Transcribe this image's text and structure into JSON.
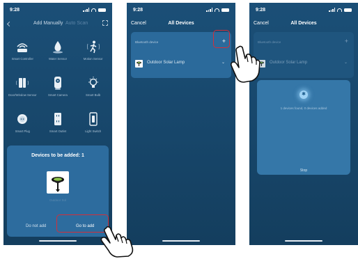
{
  "phone1": {
    "status_time": "9:28",
    "tabs": {
      "add_manually": "Add Manually",
      "auto_scan": "Auto Scan"
    },
    "devices": [
      {
        "label": "Smart Controller",
        "icon": "router-icon"
      },
      {
        "label": "Water Sensor",
        "icon": "water-drop-icon"
      },
      {
        "label": "Motion Sensor",
        "icon": "motion-person-icon"
      },
      {
        "label": "Door/Window Sensor",
        "icon": "door-sensor-icon"
      },
      {
        "label": "Smart Camera",
        "icon": "camera-icon"
      },
      {
        "label": "Smart Bulb",
        "icon": "bulb-icon"
      },
      {
        "label": "Smart Plug",
        "icon": "plug-icon"
      },
      {
        "label": "Smart Outlet",
        "icon": "outlet-icon"
      },
      {
        "label": "Light Switch",
        "icon": "light-switch-icon"
      }
    ],
    "sheet": {
      "title": "Devices to be added: 1",
      "device_label": "Outdoor Sol",
      "do_not_add": "Do not add",
      "go_to_add": "Go to add"
    }
  },
  "phone2": {
    "status_time": "9:28",
    "nav": {
      "cancel": "Cancel",
      "title": "All Devices"
    },
    "card": {
      "header": "Bluetooth device",
      "add_symbol": "+",
      "device_name": "Outdoor Solar Lamp",
      "chevron": "⌄"
    }
  },
  "phone3": {
    "status_time": "9:28",
    "nav": {
      "cancel": "Cancel",
      "title": "All Devices"
    },
    "card": {
      "header": "Bluetooth device",
      "add_symbol": "+",
      "device_name": "Outdoor Solar Lamp",
      "chevron": "⌄"
    },
    "modal": {
      "found_text": "1 devices found, 0 devices added",
      "stop": "Stop"
    }
  },
  "colors": {
    "phone_bg": "#1b4f77",
    "card_bg": "#2b6a9b",
    "highlight": "#d32f3a"
  }
}
